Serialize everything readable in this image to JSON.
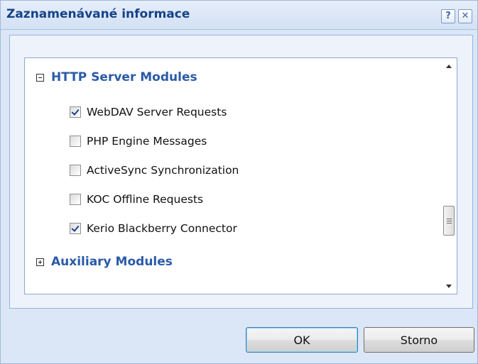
{
  "dialog": {
    "title": "Zaznamenávané informace",
    "help_label": "?",
    "close_label": "✕"
  },
  "tree": {
    "groups": [
      {
        "label": "HTTP Server Modules",
        "expanded": true,
        "items": [
          {
            "label": "WebDAV Server Requests",
            "checked": true
          },
          {
            "label": "PHP Engine Messages",
            "checked": false
          },
          {
            "label": "ActiveSync Synchronization",
            "checked": false
          },
          {
            "label": "KOC Offline Requests",
            "checked": false
          },
          {
            "label": "Kerio Blackberry Connector",
            "checked": true
          }
        ]
      },
      {
        "label": "Auxiliary Modules",
        "expanded": false,
        "items": []
      }
    ]
  },
  "buttons": {
    "ok_label": "OK",
    "cancel_label": "Storno"
  }
}
